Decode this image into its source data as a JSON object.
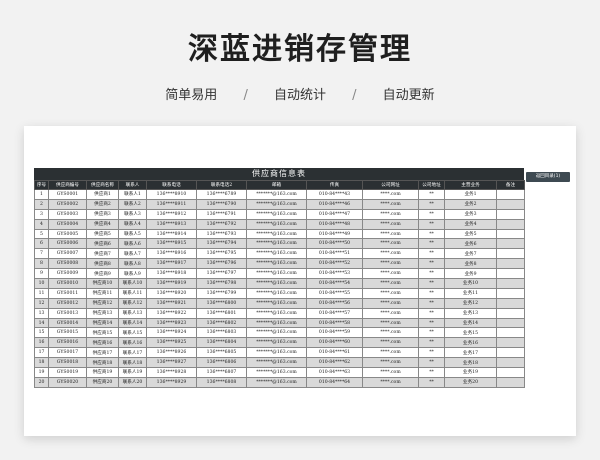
{
  "header": {
    "title": "深蓝进销存管理",
    "features": [
      "简单易用",
      "自动统计",
      "自动更新"
    ],
    "separator": "/"
  },
  "sheet": {
    "title": "供应商信息表",
    "columns": [
      "序号",
      "供应商编号",
      "供应商名称",
      "联系人",
      "联系电话",
      "联系电话2",
      "邮箱",
      "传真",
      "公司网址",
      "公司地址",
      "主营业务",
      "备注"
    ],
    "rows": [
      [
        "1",
        "GYS0001",
        "供应商1",
        "联系人1",
        "136****8910",
        "136****6789",
        "*******@163.com",
        "010-84****43",
        "****.com",
        "**",
        "业务1",
        ""
      ],
      [
        "2",
        "GYS0002",
        "供应商2",
        "联系人2",
        "136****8911",
        "136****6790",
        "*******@163.com",
        "010-84****46",
        "****.com",
        "**",
        "业务2",
        ""
      ],
      [
        "3",
        "GYS0003",
        "供应商3",
        "联系人3",
        "136****8912",
        "136****6791",
        "*******@163.com",
        "010-84****47",
        "****.com",
        "**",
        "业务3",
        ""
      ],
      [
        "4",
        "GYS0004",
        "供应商4",
        "联系人4",
        "136****8913",
        "136****6792",
        "*******@163.com",
        "010-84****48",
        "****.com",
        "**",
        "业务4",
        ""
      ],
      [
        "5",
        "GYS0005",
        "供应商5",
        "联系人5",
        "136****8914",
        "136****6793",
        "*******@163.com",
        "010-84****49",
        "****.com",
        "**",
        "业务5",
        ""
      ],
      [
        "6",
        "GYS0006",
        "供应商6",
        "联系人6",
        "136****8915",
        "136****6794",
        "*******@163.com",
        "010-84****50",
        "****.com",
        "**",
        "业务6",
        ""
      ],
      [
        "7",
        "GYS0007",
        "供应商7",
        "联系人7",
        "136****8916",
        "136****6795",
        "*******@163.com",
        "010-84****51",
        "****.com",
        "**",
        "业务7",
        ""
      ],
      [
        "8",
        "GYS0008",
        "供应商8",
        "联系人8",
        "136****8917",
        "136****6796",
        "*******@163.com",
        "010-84****52",
        "****.com",
        "**",
        "业务8",
        ""
      ],
      [
        "9",
        "GYS0009",
        "供应商9",
        "联系人9",
        "136****8918",
        "136****6797",
        "*******@163.com",
        "010-84****53",
        "****.com",
        "**",
        "业务9",
        ""
      ],
      [
        "10",
        "GYS0010",
        "供应商10",
        "联系人10",
        "136****8919",
        "136****6798",
        "*******@163.com",
        "010-84****54",
        "****.com",
        "**",
        "业务10",
        ""
      ],
      [
        "11",
        "GYS0011",
        "供应商11",
        "联系人11",
        "136****8920",
        "136****6799",
        "*******@163.com",
        "010-84****55",
        "****.com",
        "**",
        "业务11",
        ""
      ],
      [
        "12",
        "GYS0012",
        "供应商12",
        "联系人12",
        "136****8921",
        "136****6800",
        "*******@163.com",
        "010-84****56",
        "****.com",
        "**",
        "业务12",
        ""
      ],
      [
        "13",
        "GYS0013",
        "供应商13",
        "联系人13",
        "136****8922",
        "136****6801",
        "*******@163.com",
        "010-84****57",
        "****.com",
        "**",
        "业务13",
        ""
      ],
      [
        "14",
        "GYS0014",
        "供应商14",
        "联系人14",
        "136****8923",
        "136****6802",
        "*******@163.com",
        "010-84****58",
        "****.com",
        "**",
        "业务14",
        ""
      ],
      [
        "15",
        "GYS0015",
        "供应商15",
        "联系人15",
        "136****8924",
        "136****6803",
        "*******@163.com",
        "010-84****59",
        "****.com",
        "**",
        "业务15",
        ""
      ],
      [
        "16",
        "GYS0016",
        "供应商16",
        "联系人16",
        "136****8925",
        "136****6804",
        "*******@163.com",
        "010-84****60",
        "****.com",
        "**",
        "业务16",
        ""
      ],
      [
        "17",
        "GYS0017",
        "供应商17",
        "联系人17",
        "136****8926",
        "136****6805",
        "*******@163.com",
        "010-84****61",
        "****.com",
        "**",
        "业务17",
        ""
      ],
      [
        "18",
        "GYS0018",
        "供应商18",
        "联系人18",
        "136****8927",
        "136****6806",
        "*******@163.com",
        "010-84****62",
        "****.com",
        "**",
        "业务18",
        ""
      ],
      [
        "19",
        "GYS0019",
        "供应商19",
        "联系人19",
        "136****8928",
        "136****6807",
        "*******@163.com",
        "010-84****63",
        "****.com",
        "**",
        "业务19",
        ""
      ],
      [
        "20",
        "GYS0020",
        "供应商20",
        "联系人20",
        "136****8929",
        "136****6808",
        "*******@163.com",
        "010-84****64",
        "****.com",
        "**",
        "业务20",
        ""
      ]
    ]
  },
  "side_button": {
    "label": "返回目录(1)"
  },
  "colors": {
    "header_bg": "#2b3033",
    "row_alt": "#d9d9d9"
  }
}
